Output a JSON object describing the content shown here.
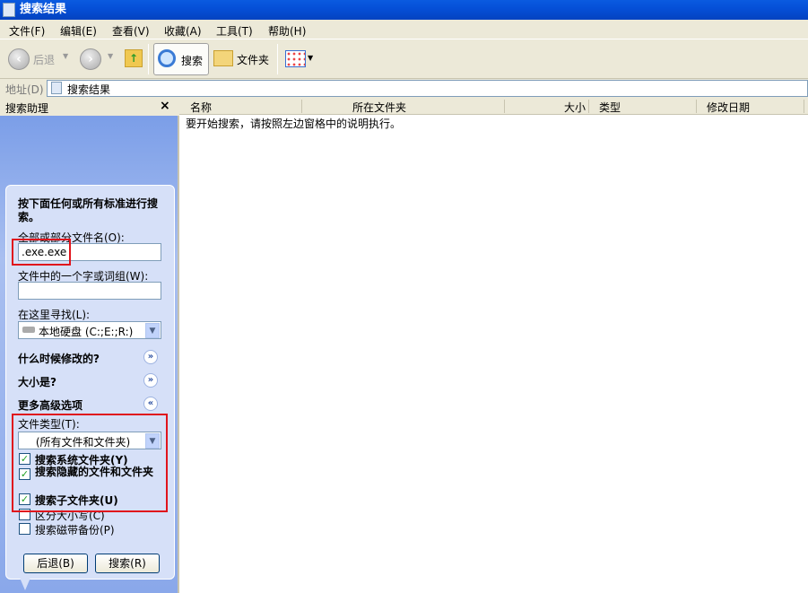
{
  "window": {
    "title": "搜索结果"
  },
  "menu": [
    "文件(F)",
    "编辑(E)",
    "查看(V)",
    "收藏(A)",
    "工具(T)",
    "帮助(H)"
  ],
  "toolbar": {
    "back": "后退",
    "search": "搜索",
    "folders": "文件夹"
  },
  "address": {
    "label": "地址(D)",
    "value": "搜索结果"
  },
  "pane": {
    "title": "搜索助理",
    "close": "×"
  },
  "columns": [
    "名称",
    "所在文件夹",
    "大小",
    "类型",
    "修改日期"
  ],
  "list": {
    "empty_message": "要开始搜索，请按照左边窗格中的说明执行。"
  },
  "search": {
    "instructions": "按下面任何或所有标准进行搜索。",
    "filename_label": "全部或部分文件名(O):",
    "filename_value": ".exe.exe",
    "word_label": "文件中的一个字或词组(W):",
    "word_value": "",
    "lookin_label": "在这里寻找(L):",
    "lookin_value": "本地硬盘 (C:;E:;R:)",
    "when_modified": "什么时候修改的?",
    "size": "大小是?",
    "advanced": "更多高级选项",
    "filetype_label": "文件类型(T):",
    "filetype_value": "(所有文件和文件夹)",
    "options": [
      {
        "label": "搜索系统文件夹(Y)",
        "checked": true
      },
      {
        "label": "搜索隐藏的文件和文件夹",
        "checked": true
      },
      {
        "label": "搜索子文件夹(U)",
        "checked": true
      },
      {
        "label": "区分大小写(C)",
        "checked": false
      },
      {
        "label": "搜索磁带备份(P)",
        "checked": false
      }
    ],
    "back_button": "后退(B)",
    "search_button": "搜索(R)"
  },
  "colors": {
    "titlebar": "#0550d8",
    "highlight": "#e0141c",
    "panel": "#d6e0f8"
  }
}
